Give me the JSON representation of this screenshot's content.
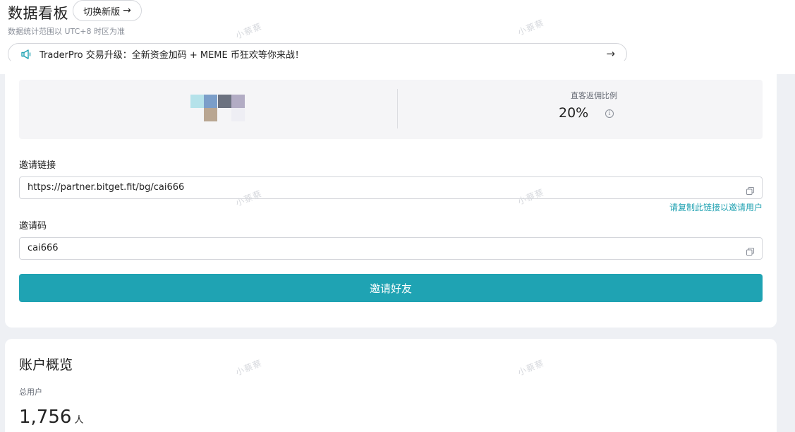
{
  "header": {
    "title": "数据看板",
    "switch_label": "切换新版",
    "subtitle": "数据统计范围以 UTC+8 时区为准",
    "notice": "TraderPro 交易升级：全新资金加码 + MEME 币狂欢等你来战！"
  },
  "invite": {
    "rebate_label": "直客返佣比例",
    "rebate_value": "20%",
    "link_label": "邀请链接",
    "link_value": "https://partner.bitget.fit/bg/cai666",
    "copy_hint": "请复制此链接以邀请用户",
    "code_label": "邀请码",
    "code_value": "cai666",
    "invite_button": "邀请好友"
  },
  "overview": {
    "title": "账户概览",
    "total_label": "总用户",
    "total_value": "1,756",
    "total_unit": "人"
  },
  "watermark_text": "小蔡蔡",
  "colors": {
    "accent": "#1fa3b3",
    "link": "#1fa1b1",
    "page_bg": "#eef0f4"
  }
}
